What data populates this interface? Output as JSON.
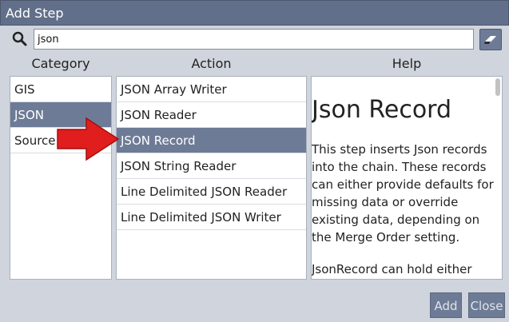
{
  "window": {
    "title": "Add Step"
  },
  "search": {
    "value": "json"
  },
  "headers": {
    "category": "Category",
    "action": "Action",
    "help": "Help"
  },
  "categories": [
    {
      "label": "GIS"
    },
    {
      "label": "JSON",
      "selected": true
    },
    {
      "label": "Source"
    }
  ],
  "actions": [
    {
      "label": "JSON Array Writer"
    },
    {
      "label": "JSON Reader"
    },
    {
      "label": "JSON Record",
      "selected": true
    },
    {
      "label": "JSON String Reader"
    },
    {
      "label": "Line Delimited JSON Reader"
    },
    {
      "label": "Line Delimited JSON Writer"
    }
  ],
  "help": {
    "title": "Json Record",
    "paragraph1": "This step inserts Json records into the chain. These records can either provide defaults for missing data or override existing data, depending on the Merge Order setting.",
    "paragraph2": "JsonRecord can hold either"
  },
  "buttons": {
    "add": "Add",
    "close": "Close"
  },
  "icons": {
    "search": "magnifier-icon",
    "clear": "eraser-icon",
    "pointer": "red-arrow-icon"
  },
  "colors": {
    "selection": "#6e7b96",
    "titlebar": "#626f8a",
    "arrow": "#e01e1e"
  }
}
